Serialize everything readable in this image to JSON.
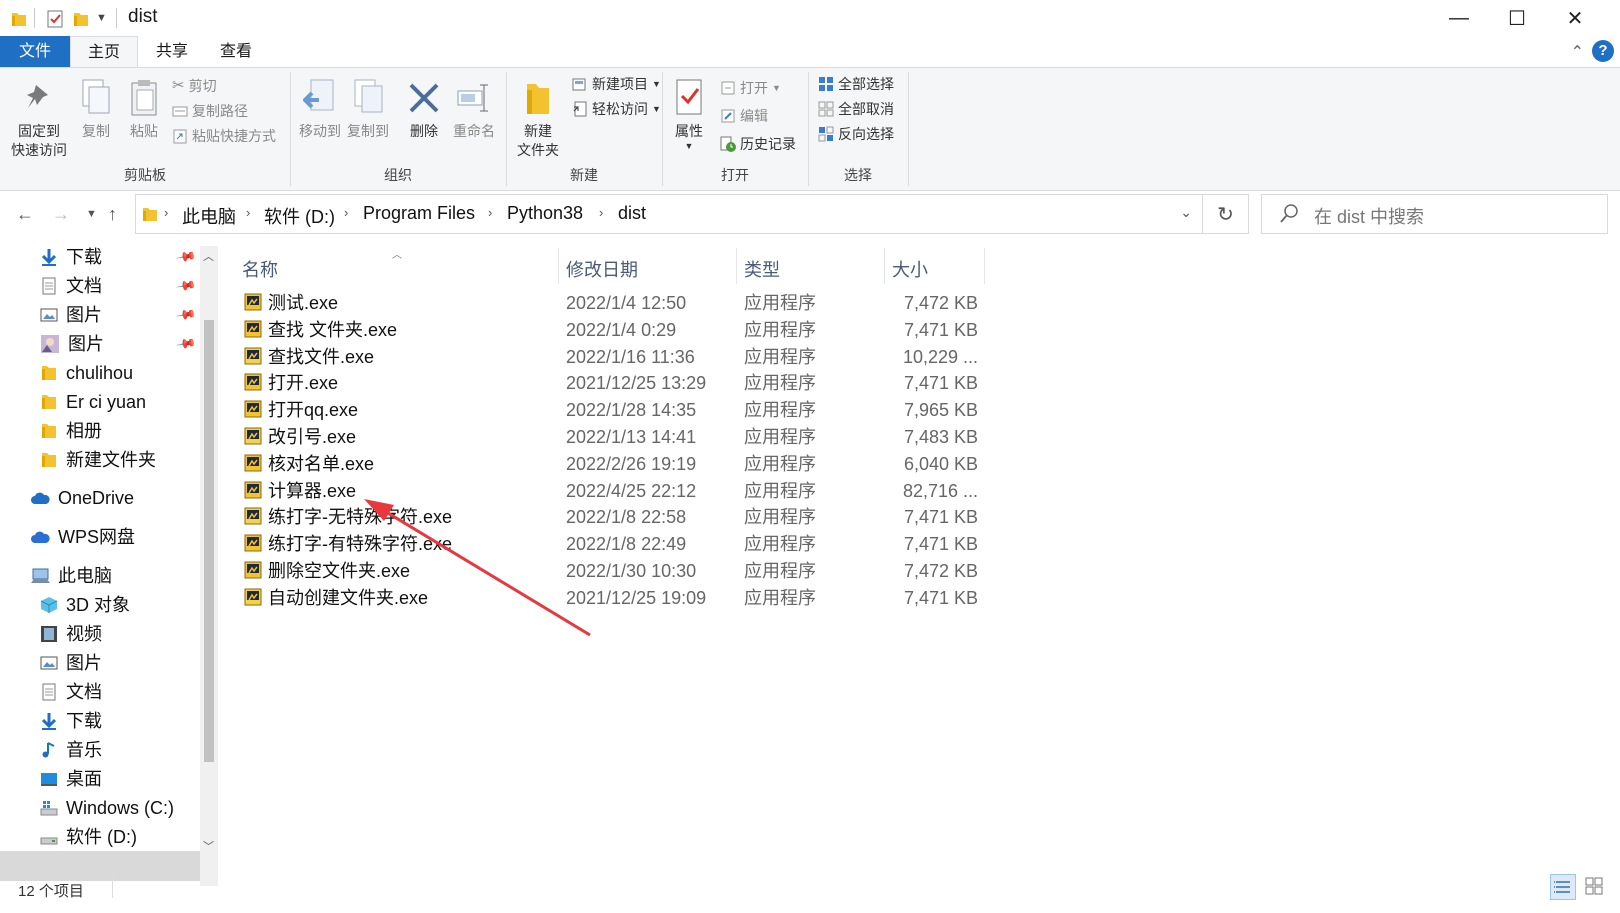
{
  "window": {
    "title": "dist",
    "title_icons": [
      "folder-icon",
      "properties-check-icon",
      "folder-icon",
      "customize-dropdown-icon"
    ],
    "controls": {
      "minimize": "—",
      "maximize": "☐",
      "close": "✕"
    }
  },
  "ribbon_tabs": [
    {
      "label": "文件"
    },
    {
      "label": "主页"
    },
    {
      "label": "共享"
    },
    {
      "label": "查看"
    }
  ],
  "ribbon": {
    "clipboard": {
      "label": "剪贴板",
      "pin": "固定到\n快速访问",
      "copy": "复制",
      "paste": "粘贴",
      "cut": "剪切",
      "copy_path": "复制路径",
      "paste_shortcut": "粘贴快捷方式"
    },
    "organize": {
      "label": "组织",
      "move_to": "移动到",
      "copy_to": "复制到",
      "delete": "删除",
      "rename": "重命名"
    },
    "new": {
      "label": "新建",
      "new_folder": "新建\n文件夹",
      "new_item": "新建项目",
      "easy_access": "轻松访问"
    },
    "open": {
      "label": "打开",
      "properties": "属性",
      "open": "打开",
      "edit": "编辑",
      "history": "历史记录"
    },
    "select": {
      "label": "选择",
      "select_all": "全部选择",
      "select_none": "全部取消",
      "invert": "反向选择"
    }
  },
  "address": {
    "crumbs": [
      "此电脑",
      "软件 (D:)",
      "Program Files",
      "Python38",
      "dist"
    ]
  },
  "search": {
    "placeholder": "在 dist 中搜索"
  },
  "sidebar": {
    "quick": [
      {
        "label": "下载",
        "icon": "download-arrow-icon",
        "pinned": true
      },
      {
        "label": "文档",
        "icon": "document-icon",
        "pinned": true
      },
      {
        "label": "图片",
        "icon": "pictures-icon",
        "pinned": true
      },
      {
        "label": "图片",
        "icon": "photo-thumbnail-icon",
        "pinned": true
      },
      {
        "label": "chulihou",
        "icon": "folder-icon",
        "pinned": false
      },
      {
        "label": "Er ci yuan",
        "icon": "folder-icon",
        "pinned": false
      },
      {
        "label": "相册",
        "icon": "folder-icon",
        "pinned": false
      },
      {
        "label": "新建文件夹",
        "icon": "folder-icon",
        "pinned": false
      }
    ],
    "onedrive": "OneDrive",
    "wps": "WPS网盘",
    "this_pc": "此电脑",
    "pc_items": [
      {
        "label": "3D 对象",
        "icon": "3d-objects-icon"
      },
      {
        "label": "视频",
        "icon": "video-icon"
      },
      {
        "label": "图片",
        "icon": "pictures-icon"
      },
      {
        "label": "文档",
        "icon": "document-icon"
      },
      {
        "label": "下载",
        "icon": "download-arrow-icon"
      },
      {
        "label": "音乐",
        "icon": "music-note-icon"
      },
      {
        "label": "桌面",
        "icon": "desktop-icon"
      },
      {
        "label": "Windows (C:)",
        "icon": "windows-drive-icon"
      },
      {
        "label": "软件 (D:)",
        "icon": "drive-icon"
      }
    ]
  },
  "columns": {
    "name": "名称",
    "date": "修改日期",
    "type": "类型",
    "size": "大小"
  },
  "files": [
    {
      "name": "测试.exe",
      "date": "2022/1/4 12:50",
      "type": "应用程序",
      "size": "7,472 KB"
    },
    {
      "name": "查找 文件夹.exe",
      "date": "2022/1/4 0:29",
      "type": "应用程序",
      "size": "7,471 KB"
    },
    {
      "name": "查找文件.exe",
      "date": "2022/1/16 11:36",
      "type": "应用程序",
      "size": "10,229 ..."
    },
    {
      "name": "打开.exe",
      "date": "2021/12/25 13:29",
      "type": "应用程序",
      "size": "7,471 KB"
    },
    {
      "name": "打开qq.exe",
      "date": "2022/1/28 14:35",
      "type": "应用程序",
      "size": "7,965 KB"
    },
    {
      "name": "改引号.exe",
      "date": "2022/1/13 14:41",
      "type": "应用程序",
      "size": "7,483 KB"
    },
    {
      "name": "核对名单.exe",
      "date": "2022/2/26 19:19",
      "type": "应用程序",
      "size": "6,040 KB"
    },
    {
      "name": "计算器.exe",
      "date": "2022/4/25 22:12",
      "type": "应用程序",
      "size": "82,716 ..."
    },
    {
      "name": "练打字-无特殊字符.exe",
      "date": "2022/1/8 22:58",
      "type": "应用程序",
      "size": "7,471 KB"
    },
    {
      "name": "练打字-有特殊字符.exe",
      "date": "2022/1/8 22:49",
      "type": "应用程序",
      "size": "7,471 KB"
    },
    {
      "name": "删除空文件夹.exe",
      "date": "2022/1/30 10:30",
      "type": "应用程序",
      "size": "7,472 KB"
    },
    {
      "name": "自动创建文件夹.exe",
      "date": "2021/12/25 19:09",
      "type": "应用程序",
      "size": "7,471 KB"
    }
  ],
  "status": {
    "count": "12 个项目"
  },
  "colors": {
    "accent": "#1f6fc5",
    "folder": "#f2c230",
    "annotation_arrow": "#e8383d"
  }
}
